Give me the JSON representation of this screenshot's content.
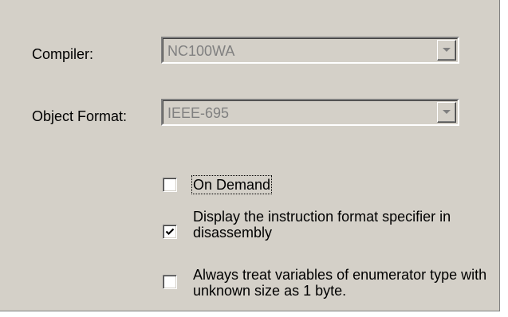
{
  "compiler": {
    "label": "Compiler:",
    "value": "NC100WA",
    "icon": "chevron-down-icon"
  },
  "object_format": {
    "label": "Object Format:",
    "value": "IEEE-695",
    "icon": "chevron-down-icon"
  },
  "options": [
    {
      "label": "On Demand",
      "checked": false
    },
    {
      "label": "Display the instruction format specifier in disassembly",
      "checked": true
    },
    {
      "label": "Always treat variables of enumerator type with unknown size as 1 byte.",
      "checked": false
    }
  ]
}
